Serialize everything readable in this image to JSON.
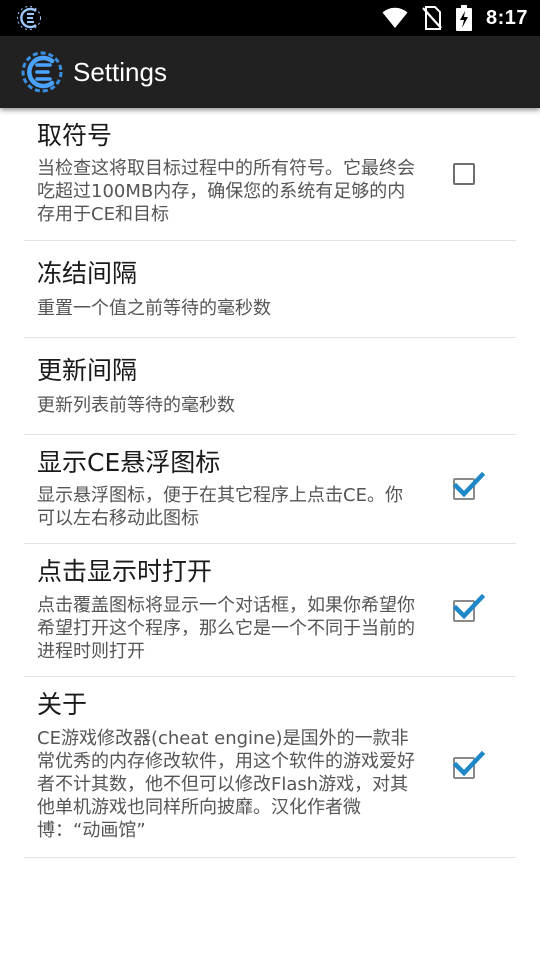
{
  "status_bar": {
    "time": "8:17",
    "icons": [
      "cheat-engine-notification-icon",
      "wifi-icon",
      "no-sim-icon",
      "battery-charging-icon"
    ]
  },
  "app_bar": {
    "title": "Settings",
    "icon": "cheat-engine-logo-icon"
  },
  "colors": {
    "status_bar_bg": "#000000",
    "app_bar_bg": "#212121",
    "accent": "#1e88c8",
    "title_text": "#1a1a1a",
    "summary_text": "#555555",
    "divider": "#e3e3e3"
  },
  "preferences": [
    {
      "title": "取符号",
      "summary": "当检查这将取目标过程中的所有符号。它最终会吃超过100MB内存，确保您的系统有足够的内存用于CE和目标",
      "checkbox": true,
      "checked": false
    },
    {
      "title": "冻结间隔",
      "summary": "重置一个值之前等待的毫秒数",
      "checkbox": false
    },
    {
      "title": "更新间隔",
      "summary": "更新列表前等待的毫秒数",
      "checkbox": false
    },
    {
      "title": "显示CE悬浮图标",
      "summary": "显示悬浮图标，便于在其它程序上点击CE。你可以左右移动此图标",
      "checkbox": true,
      "checked": true
    },
    {
      "title": "点击显示时打开",
      "summary": "点击覆盖图标将显示一个对话框，如果你希望你希望打开这个程序，那么它是一个不同于当前的进程时则打开",
      "checkbox": true,
      "checked": true
    },
    {
      "title": "关于",
      "summary": "CE游戏修改器(cheat engine)是国外的一款非常优秀的内存修改软件，用这个软件的游戏爱好者不计其数，他不但可以修改Flash游戏，对其他单机游戏也同样所向披靡。汉化作者微博：“动画馆”",
      "checkbox": true,
      "checked": true
    }
  ]
}
